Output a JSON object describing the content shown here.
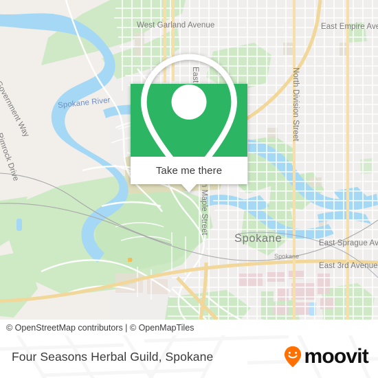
{
  "map": {
    "attribution": "© OpenStreetMap contributors | © OpenMapTiles",
    "labels": {
      "west_garland_avenue": "West Garland Avenue",
      "east_empire_avenue": "East Empire Aven",
      "spokane_river": "Spokane River",
      "government_way": "Government Way",
      "rimrock_drive": "Rimrock Drive",
      "north_division_street": "North Division Street",
      "north_maple_street": "n Maple Street",
      "east_street": "East",
      "spokane_city": "Spokane",
      "spokane_station": "Spokane",
      "east_sprague_avenue": "East Sprague Ave",
      "east_third_avenue": "East 3rd Avenue"
    },
    "colors": {
      "land": "#f2efea",
      "water": "#a5d8f5",
      "park": "#c9e8c3",
      "highway": "#f7dd9a",
      "road": "#ffffff",
      "building": "#e6e2dc",
      "residential_pink": "#ead3d7"
    }
  },
  "popup": {
    "cta_label": "Take me there",
    "accent_color": "#2cb563",
    "pin_icon": "map-pin-icon"
  },
  "footer": {
    "title": "Four Seasons Herbal Guild, Spokane",
    "brand_name": "moovit",
    "brand_pin_icon": "moovit-smiley-pin-icon",
    "brand_color": "#ff7000"
  }
}
